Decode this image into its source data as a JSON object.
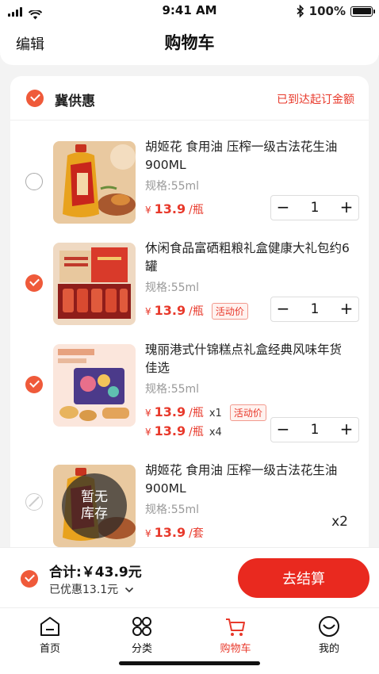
{
  "status": {
    "time": "9:41 AM",
    "battery": "100%"
  },
  "header": {
    "edit": "编辑",
    "title": "购物车"
  },
  "shop": {
    "name": "冀供惠",
    "note": "已到达起订金额"
  },
  "items": [
    {
      "title": "胡姬花 食用油 压榨一级古法花生油900ML",
      "spec": "规格:55ml",
      "currency": "¥",
      "price": "13.9",
      "unit": "/瓶",
      "qty": "1",
      "checked": false
    },
    {
      "title": "休闲食品富硒粗粮礼盒健康大礼包约6罐",
      "spec": "规格:55ml",
      "currency": "¥",
      "price": "13.9",
      "unit": "/瓶",
      "tag": "活动价",
      "qty": "1",
      "checked": true
    },
    {
      "title": "瑰丽港式什锦糕点礼盒经典风味年货佳选",
      "spec": "规格:55ml",
      "currency": "¥",
      "prices": [
        {
          "price": "13.9",
          "unit": "/瓶",
          "count": "x1",
          "tag": "活动价"
        },
        {
          "price": "13.9",
          "unit": "/瓶",
          "count": "x4"
        }
      ],
      "qty": "1",
      "checked": true
    },
    {
      "title": "胡姬花 食用油 压榨一级古法花生油900ML",
      "spec": "规格:55ml",
      "currency": "¥",
      "price": "13.9",
      "unit": "/套",
      "multiplier": "x2",
      "out_of_stock_line1": "暂无",
      "out_of_stock_line2": "库存"
    }
  ],
  "stepper": {
    "minus": "−",
    "plus": "+"
  },
  "bottom": {
    "total": "合计:￥43.9元",
    "saved": "已优惠13.1元",
    "checkout": "去结算"
  },
  "tabs": [
    {
      "label": "首页",
      "icon": "home-icon"
    },
    {
      "label": "分类",
      "icon": "category-icon"
    },
    {
      "label": "购物车",
      "icon": "cart-icon",
      "active": true
    },
    {
      "label": "我的",
      "icon": "profile-icon"
    }
  ],
  "colors": {
    "accent": "#e8392b",
    "check": "#ef5a3a",
    "button": "#e9291f"
  }
}
